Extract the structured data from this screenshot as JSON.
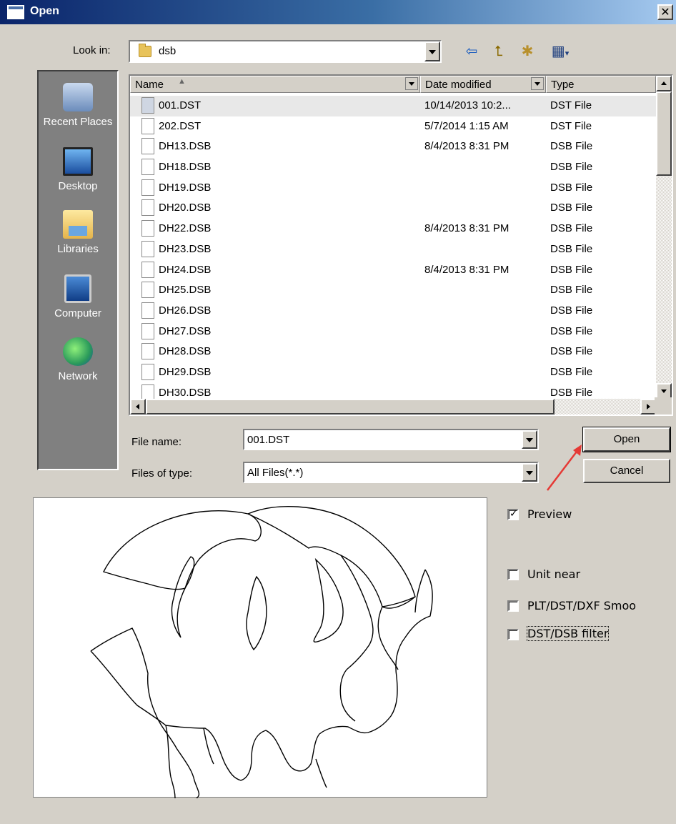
{
  "window": {
    "title": "Open",
    "close_glyph": "✕"
  },
  "lookin": {
    "label": "Look in:",
    "value": "dsb"
  },
  "toolbar": {
    "back_glyph": "⇦",
    "up_glyph": "⮤",
    "newfolder_glyph": "✱",
    "views_glyph": "▦"
  },
  "places": [
    {
      "label": "Recent Places",
      "icon": "recent-places-icon"
    },
    {
      "label": "Desktop",
      "icon": "desktop-icon"
    },
    {
      "label": "Libraries",
      "icon": "libraries-icon"
    },
    {
      "label": "Computer",
      "icon": "computer-icon"
    },
    {
      "label": "Network",
      "icon": "network-icon"
    }
  ],
  "list": {
    "columns": {
      "name": "Name",
      "sort_glyph": "▲",
      "date": "Date modified",
      "type": "Type"
    },
    "rows": [
      {
        "name": "001.DST",
        "date": "10/14/2013 10:2...",
        "type": "DST File",
        "selected": true
      },
      {
        "name": "202.DST",
        "date": "5/7/2014 1:15 AM",
        "type": "DST File"
      },
      {
        "name": "DH13.DSB",
        "date": "8/4/2013 8:31 PM",
        "type": "DSB File"
      },
      {
        "name": "DH18.DSB",
        "date": "",
        "type": "DSB File"
      },
      {
        "name": "DH19.DSB",
        "date": "",
        "type": "DSB File"
      },
      {
        "name": "DH20.DSB",
        "date": "",
        "type": "DSB File"
      },
      {
        "name": "DH22.DSB",
        "date": "8/4/2013 8:31 PM",
        "type": "DSB File"
      },
      {
        "name": "DH23.DSB",
        "date": "",
        "type": "DSB File"
      },
      {
        "name": "DH24.DSB",
        "date": "8/4/2013 8:31 PM",
        "type": "DSB File"
      },
      {
        "name": "DH25.DSB",
        "date": "",
        "type": "DSB File"
      },
      {
        "name": "DH26.DSB",
        "date": "",
        "type": "DSB File"
      },
      {
        "name": "DH27.DSB",
        "date": "",
        "type": "DSB File"
      },
      {
        "name": "DH28.DSB",
        "date": "",
        "type": "DSB File"
      },
      {
        "name": "DH29.DSB",
        "date": "",
        "type": "DSB File"
      },
      {
        "name": "DH30.DSB",
        "date": "",
        "type": "DSB File"
      }
    ]
  },
  "filename": {
    "label": "File name:",
    "value": "001.DST"
  },
  "filetype": {
    "label": "Files of type:",
    "value": "All Files(*.*)"
  },
  "buttons": {
    "open": "Open",
    "cancel": "Cancel"
  },
  "options": {
    "preview": {
      "label": "Preview",
      "checked": true
    },
    "unit_near": {
      "label": "Unit near",
      "checked": false
    },
    "smooth": {
      "label": "PLT/DST/DXF Smoo",
      "checked": false
    },
    "filter": {
      "label": "DST/DSB filter",
      "checked": false
    }
  },
  "colors": {
    "face": "#d4d0c8",
    "places_bg": "#808080",
    "title_start": "#0a246a",
    "annotation_arrow": "#e53935"
  }
}
